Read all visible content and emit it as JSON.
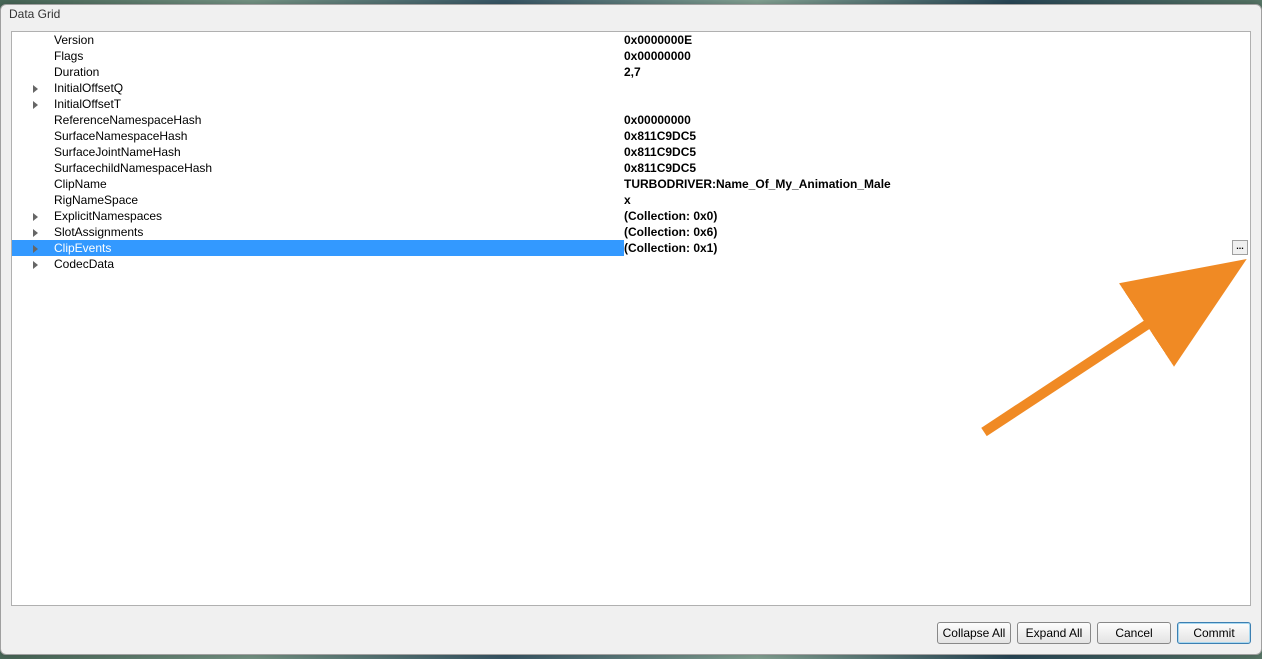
{
  "window": {
    "title": "Data Grid"
  },
  "rows": [
    {
      "expandable": false,
      "label": "Version",
      "value": "0x0000000E",
      "selected": false
    },
    {
      "expandable": false,
      "label": "Flags",
      "value": "0x00000000",
      "selected": false
    },
    {
      "expandable": false,
      "label": "Duration",
      "value": "2,7",
      "selected": false
    },
    {
      "expandable": true,
      "label": "InitialOffsetQ",
      "value": "",
      "selected": false
    },
    {
      "expandable": true,
      "label": "InitialOffsetT",
      "value": "",
      "selected": false
    },
    {
      "expandable": false,
      "label": "ReferenceNamespaceHash",
      "value": "0x00000000",
      "selected": false
    },
    {
      "expandable": false,
      "label": "SurfaceNamespaceHash",
      "value": "0x811C9DC5",
      "selected": false
    },
    {
      "expandable": false,
      "label": "SurfaceJointNameHash",
      "value": "0x811C9DC5",
      "selected": false
    },
    {
      "expandable": false,
      "label": "SurfacechildNamespaceHash",
      "value": "0x811C9DC5",
      "selected": false
    },
    {
      "expandable": false,
      "label": "ClipName",
      "value": "TURBODRIVER:Name_Of_My_Animation_Male",
      "selected": false
    },
    {
      "expandable": false,
      "label": "RigNameSpace",
      "value": "x",
      "selected": false
    },
    {
      "expandable": true,
      "label": "ExplicitNamespaces",
      "value": "(Collection: 0x0)",
      "selected": false
    },
    {
      "expandable": true,
      "label": "SlotAssignments",
      "value": "(Collection: 0x6)",
      "selected": false
    },
    {
      "expandable": true,
      "label": "ClipEvents",
      "value": "(Collection: 0x1)",
      "selected": true,
      "ellipsis": true
    },
    {
      "expandable": true,
      "label": "CodecData",
      "value": "",
      "selected": false
    }
  ],
  "buttons": {
    "collapse_all": "Collapse All",
    "expand_all": "Expand All",
    "cancel": "Cancel",
    "commit": "Commit"
  },
  "ellipsis_label": "..."
}
